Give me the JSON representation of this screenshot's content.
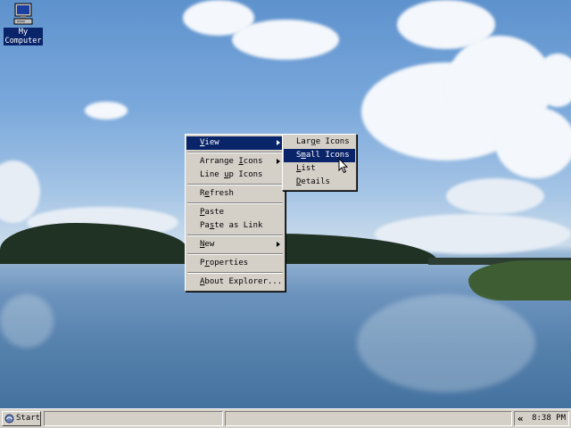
{
  "desktop": {
    "icons": [
      {
        "label": "My Computer",
        "icon": "computer-icon"
      }
    ]
  },
  "context_menu": {
    "items": [
      {
        "label": "View",
        "underline": "V",
        "submenu": true,
        "highlighted": true
      },
      {
        "separator": true
      },
      {
        "label": "Arrange Icons",
        "underline": "I",
        "submenu": true
      },
      {
        "label": "Line up Icons",
        "underline": "u"
      },
      {
        "separator": true
      },
      {
        "label": "Refresh",
        "underline": "e"
      },
      {
        "separator": true
      },
      {
        "label": "Paste",
        "underline": "P"
      },
      {
        "label": "Paste as Link",
        "underline": "s"
      },
      {
        "separator": true
      },
      {
        "label": "New",
        "underline": "N",
        "submenu": true
      },
      {
        "separator": true
      },
      {
        "label": "Properties",
        "underline": "r"
      },
      {
        "separator": true
      },
      {
        "label": "About Explorer...",
        "underline": "A"
      }
    ]
  },
  "view_submenu": {
    "items": [
      {
        "label": "Large Icons",
        "underline": "g"
      },
      {
        "label": "Small Icons",
        "underline": "m",
        "highlighted": true
      },
      {
        "label": "List",
        "underline": "L"
      },
      {
        "label": "Details",
        "underline": "D"
      }
    ]
  },
  "taskbar": {
    "start_label": "Start",
    "tray_arrow": "«",
    "clock": "8:38 PM"
  },
  "colors": {
    "menu_face": "#d4d0c8",
    "highlight": "#0a246a",
    "highlight_text": "#ffffff"
  }
}
